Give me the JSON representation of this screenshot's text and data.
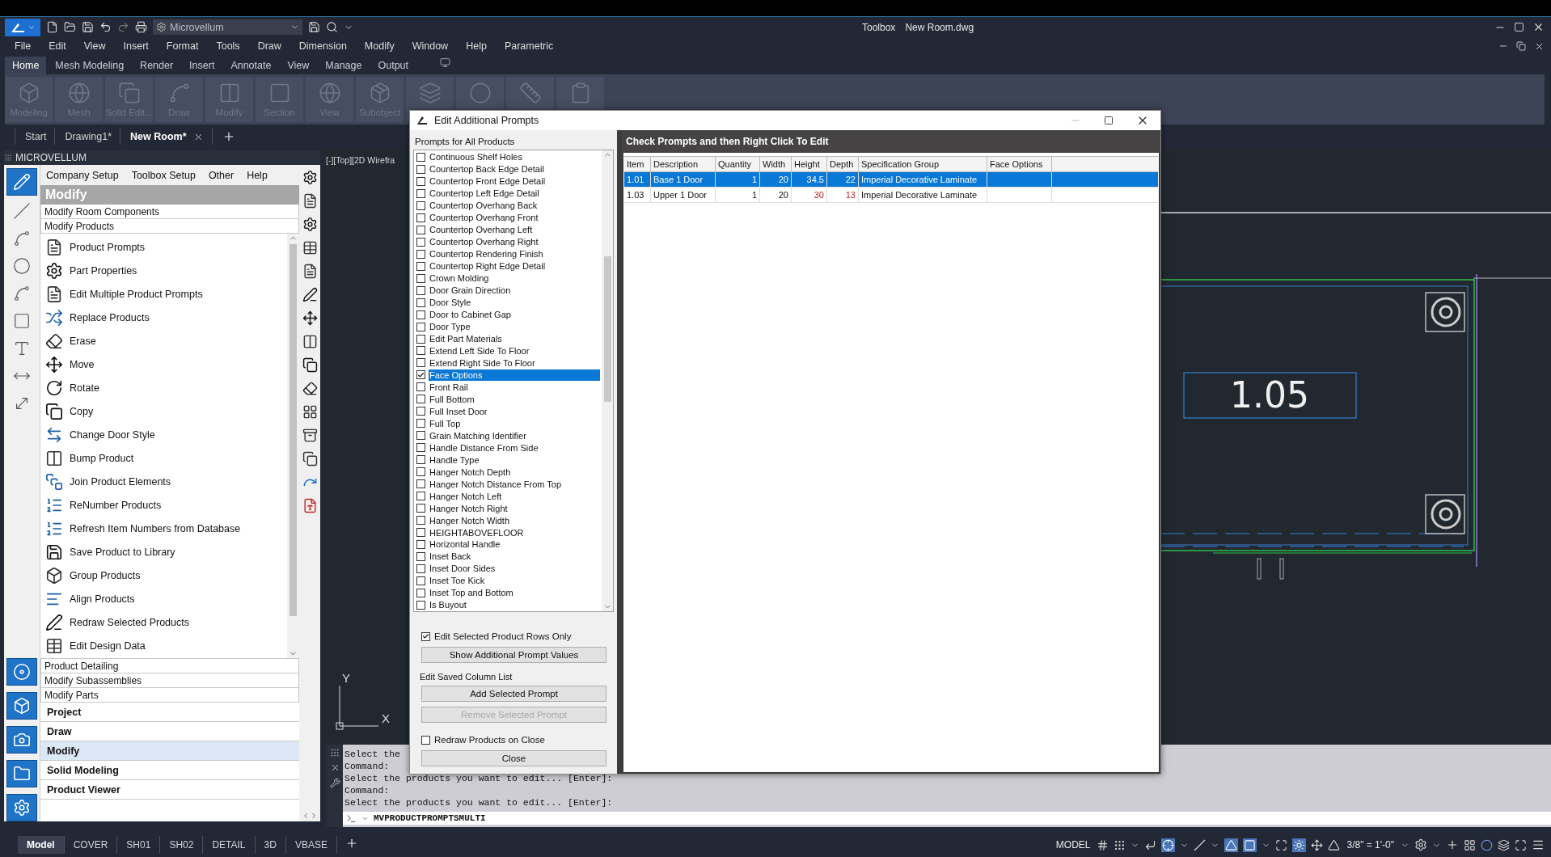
{
  "titlebar": {
    "workspace": "Microvellum",
    "title": "Toolbox",
    "document": "New Room.dwg"
  },
  "menu": [
    "File",
    "Edit",
    "View",
    "Insert",
    "Format",
    "Tools",
    "Draw",
    "Dimension",
    "Modify",
    "Window",
    "Help",
    "Parametric"
  ],
  "ribbon_tabs": [
    {
      "label": "Home",
      "selected": true
    },
    {
      "label": "Mesh Modeling",
      "selected": false
    },
    {
      "label": "Render",
      "selected": false
    },
    {
      "label": "Insert",
      "selected": false
    },
    {
      "label": "Annotate",
      "selected": false
    },
    {
      "label": "View",
      "selected": false
    },
    {
      "label": "Manage",
      "selected": false
    },
    {
      "label": "Output",
      "selected": false
    }
  ],
  "ribbon_panels": [
    "Modeling",
    "Mesh",
    "Solid Edit...",
    "Draw",
    "Modify",
    "Section",
    "View",
    "Subobject"
  ],
  "file_tabs": [
    {
      "label": "Start",
      "selected": false
    },
    {
      "label": "Drawing1*",
      "selected": false
    },
    {
      "label": "New Room*",
      "selected": true
    }
  ],
  "palette": {
    "title": "MICROVELLUM",
    "menu": [
      "Company Setup",
      "Toolbox Setup",
      "Other",
      "Help"
    ],
    "header": "Modify",
    "sections_top": [
      "Modify Room Components",
      "Modify Products"
    ],
    "items": [
      "Product Prompts",
      "Part Properties",
      "Edit Multiple Product Prompts",
      "Replace Products",
      "Erase",
      "Move",
      "Rotate",
      "Copy",
      "Change Door Style",
      "Bump Product",
      "Join Product Elements",
      "ReNumber Products",
      "Refresh Item Numbers from Database",
      "Save Product to Library",
      "Group Products",
      "Align Products",
      "Redraw Selected Products",
      "Edit Design Data"
    ],
    "sections_bottom": [
      "Product Detailing",
      "Modify Subassemblies",
      "Modify Parts"
    ],
    "categories": [
      {
        "label": "Project",
        "selected": false
      },
      {
        "label": "Draw",
        "selected": false
      },
      {
        "label": "Modify",
        "selected": true
      },
      {
        "label": "Solid Modeling",
        "selected": false
      },
      {
        "label": "Product Viewer",
        "selected": false
      }
    ]
  },
  "canvas": {
    "viewport_label": "[-][Top][2D Wirefra",
    "dimension_label": "1.05",
    "ucs": {
      "y": "Y",
      "x": "X"
    }
  },
  "command": {
    "history": [
      "Select the",
      "Command:",
      "Select the products you want to edit... [Enter]:",
      "Command:",
      "Select the products you want to edit... [Enter]:"
    ],
    "input": "MVPRODUCTPROMPTSMULTI"
  },
  "layout_tabs": [
    {
      "label": "Model",
      "selected": true
    },
    {
      "label": "COVER",
      "selected": false
    },
    {
      "label": "SH01",
      "selected": false
    },
    {
      "label": "SH02",
      "selected": false
    },
    {
      "label": "DETAIL",
      "selected": false
    },
    {
      "label": "3D",
      "selected": false
    },
    {
      "label": "VBASE",
      "selected": false
    }
  ],
  "status": {
    "space": "MODEL",
    "scale": "3/8\" = 1'-0\""
  },
  "dialog": {
    "title": "Edit Additional Prompts",
    "list_heading": "Prompts for All Products",
    "prompts": [
      {
        "label": "Continuous Shelf Holes",
        "checked": false,
        "selected": false
      },
      {
        "label": "Countertop Back Edge Detail",
        "checked": false,
        "selected": false
      },
      {
        "label": "Countertop Front Edge Detail",
        "checked": false,
        "selected": false
      },
      {
        "label": "Countertop Left Edge Detail",
        "checked": false,
        "selected": false
      },
      {
        "label": "Countertop Overhang Back",
        "checked": false,
        "selected": false
      },
      {
        "label": "Countertop Overhang Front",
        "checked": false,
        "selected": false
      },
      {
        "label": "Countertop Overhang Left",
        "checked": false,
        "selected": false
      },
      {
        "label": "Countertop Overhang Right",
        "checked": false,
        "selected": false
      },
      {
        "label": "Countertop Rendering Finish",
        "checked": false,
        "selected": false
      },
      {
        "label": "Countertop Right Edge Detail",
        "checked": false,
        "selected": false
      },
      {
        "label": "Crown Molding",
        "checked": false,
        "selected": false
      },
      {
        "label": "Door Grain Direction",
        "checked": false,
        "selected": false
      },
      {
        "label": "Door Style",
        "checked": false,
        "selected": false
      },
      {
        "label": "Door to Cabinet Gap",
        "checked": false,
        "selected": false
      },
      {
        "label": "Door Type",
        "checked": false,
        "selected": false
      },
      {
        "label": "Edit Part Materials",
        "checked": false,
        "selected": false
      },
      {
        "label": "Extend Left Side To Floor",
        "checked": false,
        "selected": false
      },
      {
        "label": "Extend Right Side To Floor",
        "checked": false,
        "selected": false
      },
      {
        "label": "Face Options",
        "checked": true,
        "selected": true
      },
      {
        "label": "Front Rail",
        "checked": false,
        "selected": false
      },
      {
        "label": "Full Bottom",
        "checked": false,
        "selected": false
      },
      {
        "label": "Full Inset Door",
        "checked": false,
        "selected": false
      },
      {
        "label": "Full Top",
        "checked": false,
        "selected": false
      },
      {
        "label": "Grain Matching Identifier",
        "checked": false,
        "selected": false
      },
      {
        "label": "Handle Distance From Side",
        "checked": false,
        "selected": false
      },
      {
        "label": "Handle Type",
        "checked": false,
        "selected": false
      },
      {
        "label": "Hanger Notch Depth",
        "checked": false,
        "selected": false
      },
      {
        "label": "Hanger Notch Distance From Top",
        "checked": false,
        "selected": false
      },
      {
        "label": "Hanger Notch Left",
        "checked": false,
        "selected": false
      },
      {
        "label": "Hanger Notch Right",
        "checked": false,
        "selected": false
      },
      {
        "label": "Hanger Notch Width",
        "checked": false,
        "selected": false
      },
      {
        "label": "HEIGHTABOVEFLOOR",
        "checked": false,
        "selected": false
      },
      {
        "label": "Horizontal Handle",
        "checked": false,
        "selected": false
      },
      {
        "label": "Inset Back",
        "checked": false,
        "selected": false
      },
      {
        "label": "Inset Door Sides",
        "checked": false,
        "selected": false
      },
      {
        "label": "Inset Toe Kick",
        "checked": false,
        "selected": false
      },
      {
        "label": "Inset Top and Bottom",
        "checked": false,
        "selected": false
      },
      {
        "label": "Is Buyout",
        "checked": false,
        "selected": false
      }
    ],
    "edit_selected_only": {
      "label": "Edit Selected Product Rows Only",
      "checked": true
    },
    "show_values_button": "Show Additional Prompt Values",
    "group_label": "Edit Saved Column List",
    "add_button": {
      "label": "Add Selected Prompt",
      "disabled": false
    },
    "remove_button": {
      "label": "Remove Selected Prompt",
      "disabled": true
    },
    "redraw_on_close": {
      "label": "Redraw Products on Close",
      "checked": false
    },
    "close_button": "Close",
    "grid_heading": "Check Prompts and then Right Click To Edit",
    "columns": [
      "Item",
      "Description",
      "Quantity",
      "Width",
      "Height",
      "Depth",
      "Specification Group",
      "Face Options"
    ],
    "rows": [
      {
        "selected": true,
        "cells": [
          {
            "text": "1.01",
            "modified": false
          },
          {
            "text": "Base 1 Door",
            "modified": false
          },
          {
            "text": "1",
            "modified": false
          },
          {
            "text": "20",
            "modified": false
          },
          {
            "text": "34.5",
            "modified": false
          },
          {
            "text": "22",
            "modified": false
          },
          {
            "text": "Imperial Decorative Laminate",
            "modified": false
          }
        ]
      },
      {
        "selected": false,
        "cells": [
          {
            "text": "1.03",
            "modified": false
          },
          {
            "text": "Upper 1 Door",
            "modified": false
          },
          {
            "text": "1",
            "modified": false
          },
          {
            "text": "20",
            "modified": false
          },
          {
            "text": "30",
            "modified": true
          },
          {
            "text": "13",
            "modified": true
          },
          {
            "text": "Imperial Decorative Laminate",
            "modified": false
          }
        ]
      }
    ]
  }
}
